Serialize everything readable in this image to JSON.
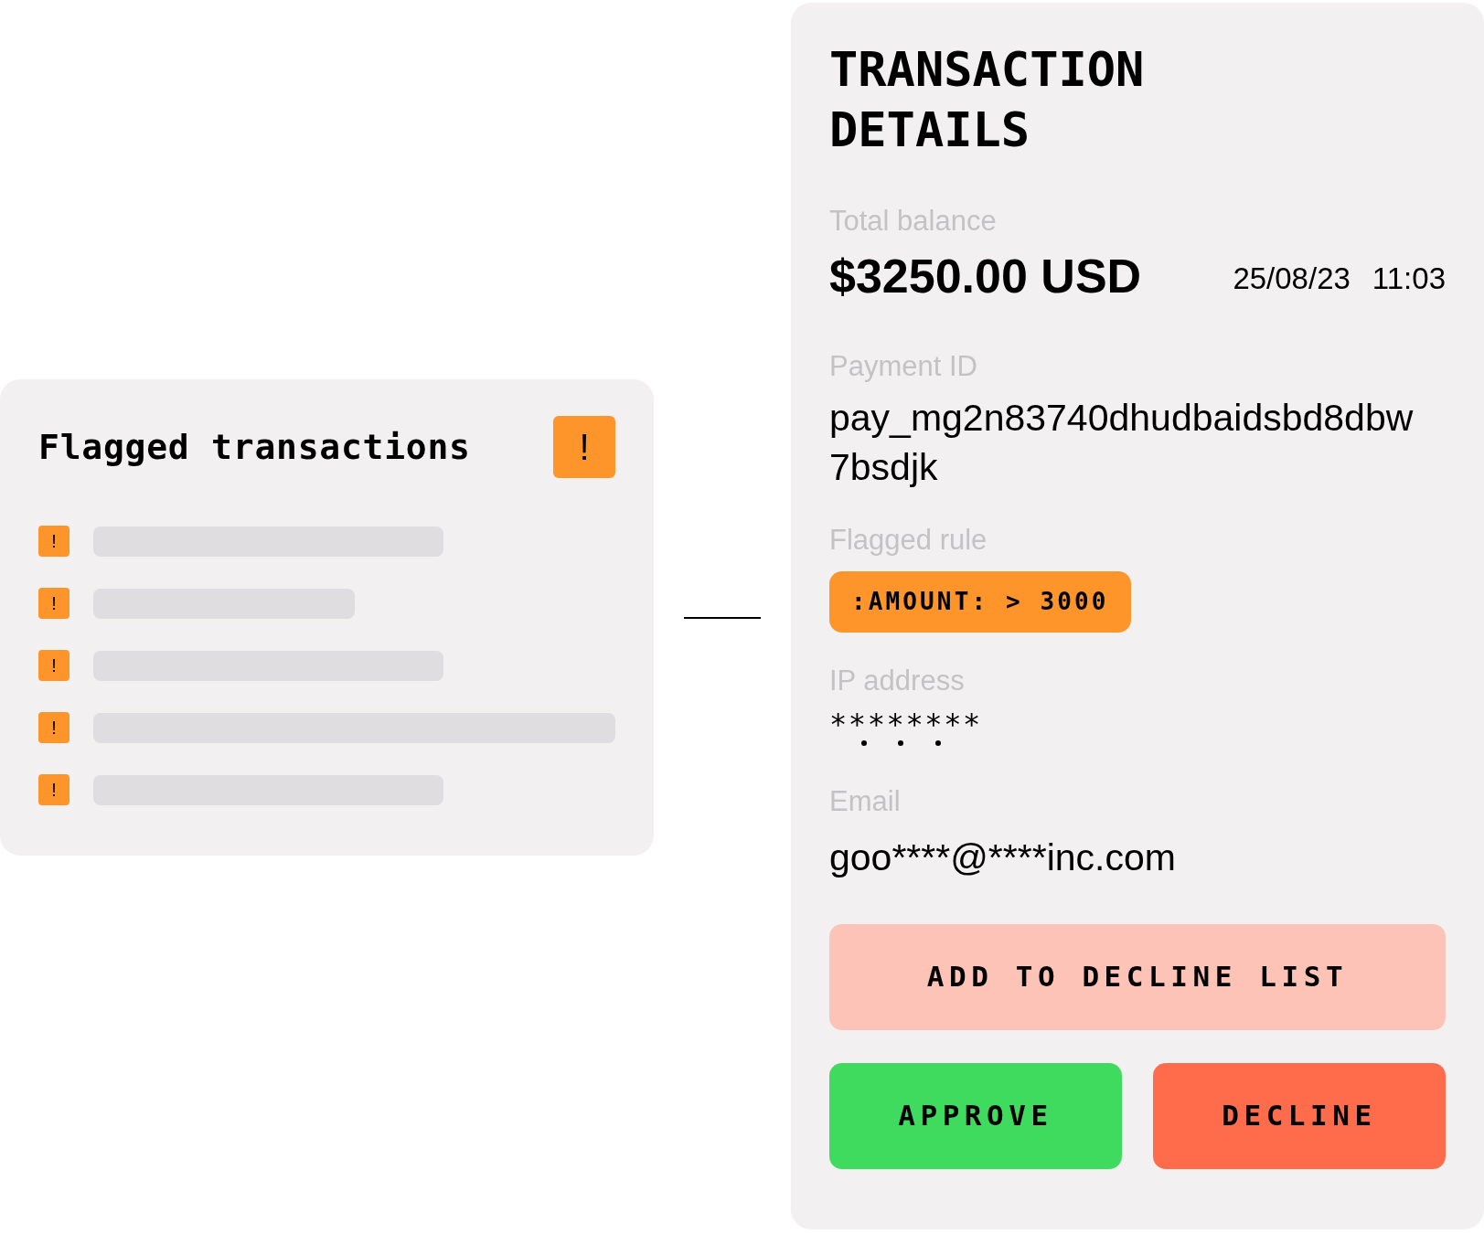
{
  "flagged_card": {
    "title": "Flagged transactions",
    "alert_icon": "!",
    "rows": [
      {
        "icon": "!"
      },
      {
        "icon": "!"
      },
      {
        "icon": "!"
      },
      {
        "icon": "!"
      },
      {
        "icon": "!"
      }
    ]
  },
  "details": {
    "title": "TRANSACTION DETAILS",
    "balance_label": "Total balance",
    "balance": "$3250.00 USD",
    "date": "25/08/23",
    "time": "11:03",
    "payment_id_label": "Payment ID",
    "payment_id": "pay_mg2n83740dhudbaidsbd8dbw7bsdjk",
    "flagged_rule_label": "Flagged rule",
    "flagged_rule": ":AMOUNT: > 3000",
    "ip_label": "IP address",
    "ip": "********",
    "email_label": "Email",
    "email": "goo****@****inc.com",
    "buttons": [
      {
        "label": "ADD TO DECLINE LIST",
        "kind": "decline-list"
      },
      {
        "label": "APPROVE",
        "kind": "approve"
      },
      {
        "label": "DECLINE",
        "kind": "decline"
      }
    ]
  }
}
